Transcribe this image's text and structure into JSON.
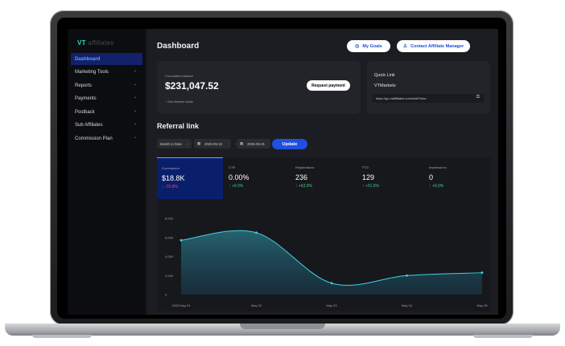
{
  "sidebar": {
    "logo_text": "VT",
    "logo_sub": "affiliates",
    "items": [
      {
        "label": "Dashboard",
        "active": true
      },
      {
        "label": "Marketing Tools"
      },
      {
        "label": "Reports"
      },
      {
        "label": "Payments"
      },
      {
        "label": "Postback"
      },
      {
        "label": "Sub Affiliates"
      },
      {
        "label": "Commission Plan"
      }
    ]
  },
  "header": {
    "title": "Dashboard",
    "my_goals": "My Goals",
    "contact_manager": "Contact Affiliate Manager"
  },
  "balance_card": {
    "label": "Cumulative balance",
    "amount": "$231,047.52",
    "request_button": "Request payment",
    "note": "See lifetime totals"
  },
  "quick_link": {
    "label": "Quick Link",
    "brand": "VTMarkets",
    "url": "https://go.vtaffiliates.com/visit/?bta="
  },
  "referral": {
    "title": "Referral link",
    "range_select": "Month to Date",
    "date_from": "2025-05-10",
    "date_to": "2025-05-31",
    "update_button": "Update"
  },
  "stats": [
    {
      "label": "Commission",
      "value": "$18.8K",
      "change": "↓ -70.9%",
      "trend": "down"
    },
    {
      "label": "CTR",
      "value": "0.00%",
      "change": "↑ +0.0%",
      "trend": "up"
    },
    {
      "label": "Registrations",
      "value": "236",
      "change": "↑ +63.9%",
      "trend": "up"
    },
    {
      "label": "FTD",
      "value": "129",
      "change": "↑ +31.6%",
      "trend": "up"
    },
    {
      "label": "Impressions",
      "value": "0",
      "change": "↑ +0.0%",
      "trend": "up"
    }
  ],
  "colors": {
    "accent": "#1f4fe0",
    "line": "#3fd3e6",
    "down": "#ff4d5e",
    "up": "#3bd17a"
  },
  "chart_data": {
    "type": "area",
    "x": [
      "2025 May 01",
      "May 02",
      "May 03",
      "May 04",
      "May 05"
    ],
    "values": [
      5700,
      6500,
      1200,
      2000,
      2300
    ],
    "yticks": [
      "0",
      "2,000",
      "4,000",
      "6,000",
      "8,000"
    ],
    "ylim": [
      0,
      8000
    ]
  }
}
